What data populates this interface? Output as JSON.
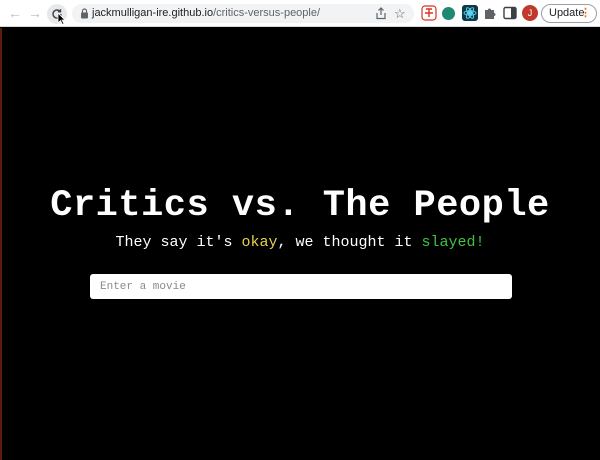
{
  "browser": {
    "url_host": "jackmulligan-ire.github.io",
    "url_path": "/critics-versus-people/",
    "update_label": "Update",
    "avatar_initial": "J",
    "icons": {
      "back": "arrow-left-icon",
      "forward": "arrow-right-icon",
      "reload": "reload-icon",
      "lock": "lock-icon",
      "share": "share-icon",
      "bookmark": "star-icon",
      "extensions": "puzzle-icon",
      "side_panel": "side-panel-icon",
      "menu": "kebab-icon"
    }
  },
  "page": {
    "title": "Critics vs. The People",
    "subtitle": {
      "part1": "They say it's ",
      "okay": "okay",
      "part2": ", we thought it ",
      "slayed": "slayed!"
    },
    "search_placeholder": "Enter a movie"
  },
  "colors": {
    "background": "#000000",
    "text": "#ffffff",
    "okay": "#e6d34a",
    "slayed": "#3fc43f"
  }
}
